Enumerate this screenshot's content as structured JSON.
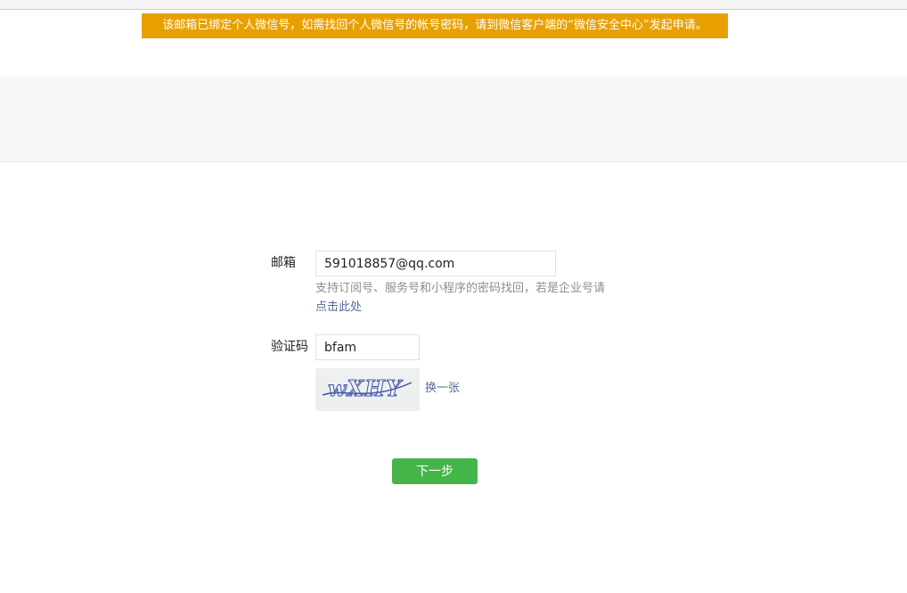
{
  "notice": {
    "text": "该邮箱已绑定个人微信号，如需找回个人微信号的帐号密码，请到微信客户端的“微信安全中心”发起申请。"
  },
  "form": {
    "email": {
      "label": "邮箱",
      "value": "591018857@qq.com",
      "tip": "支持订阅号、服务号和小程序的密码找回，若是企业号请",
      "tip_link": "点击此处"
    },
    "captcha": {
      "label": "验证码",
      "value": "bfam",
      "image_text": "wXHY",
      "refresh_label": "换一张"
    },
    "next_label": "下一步"
  },
  "colors": {
    "notice_bg": "#e8a000",
    "primary_button": "#44b549",
    "link": "#576b95"
  }
}
